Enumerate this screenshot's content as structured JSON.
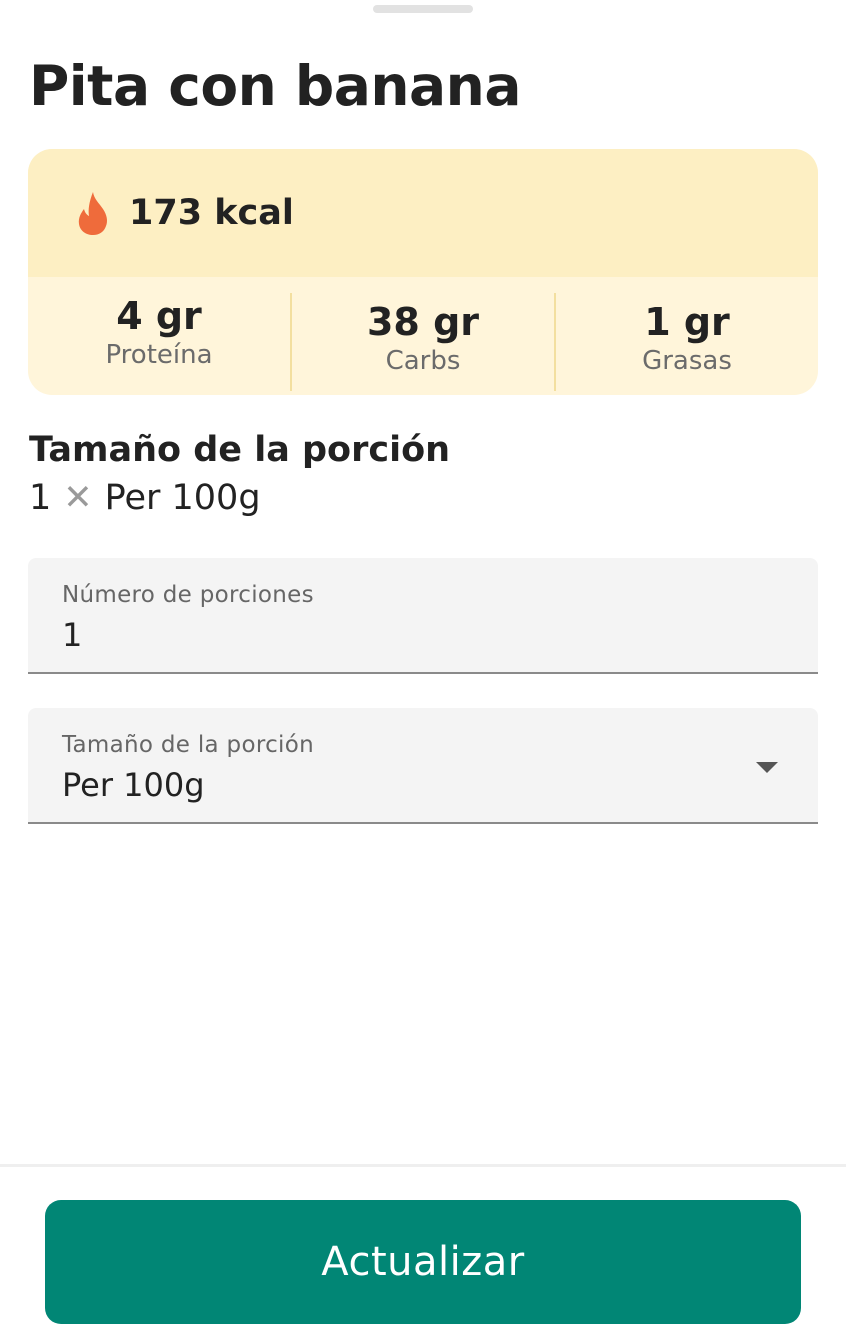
{
  "food": {
    "title": "Pita con banana"
  },
  "nutrition": {
    "calories_label": "173 kcal",
    "icon": "flame-icon",
    "macros": [
      {
        "value": "4 gr",
        "label": "Proteína"
      },
      {
        "value": "38 gr",
        "label": "Carbs"
      },
      {
        "value": "1 gr",
        "label": "Grasas"
      }
    ]
  },
  "portion": {
    "heading": "Tamaño de la porción",
    "quantity": "1",
    "times_symbol": "✕",
    "unit": "Per 100g"
  },
  "form": {
    "servings_field": {
      "label": "Número de porciones",
      "value": "1"
    },
    "size_field": {
      "label": "Tamaño de la porción",
      "value": "Per 100g"
    }
  },
  "actions": {
    "update_label": "Actualizar"
  },
  "colors": {
    "card_top": "#fdefc3",
    "card_bottom": "#fff5da",
    "flame": "#ef6b3b",
    "primary_button": "#018675"
  }
}
